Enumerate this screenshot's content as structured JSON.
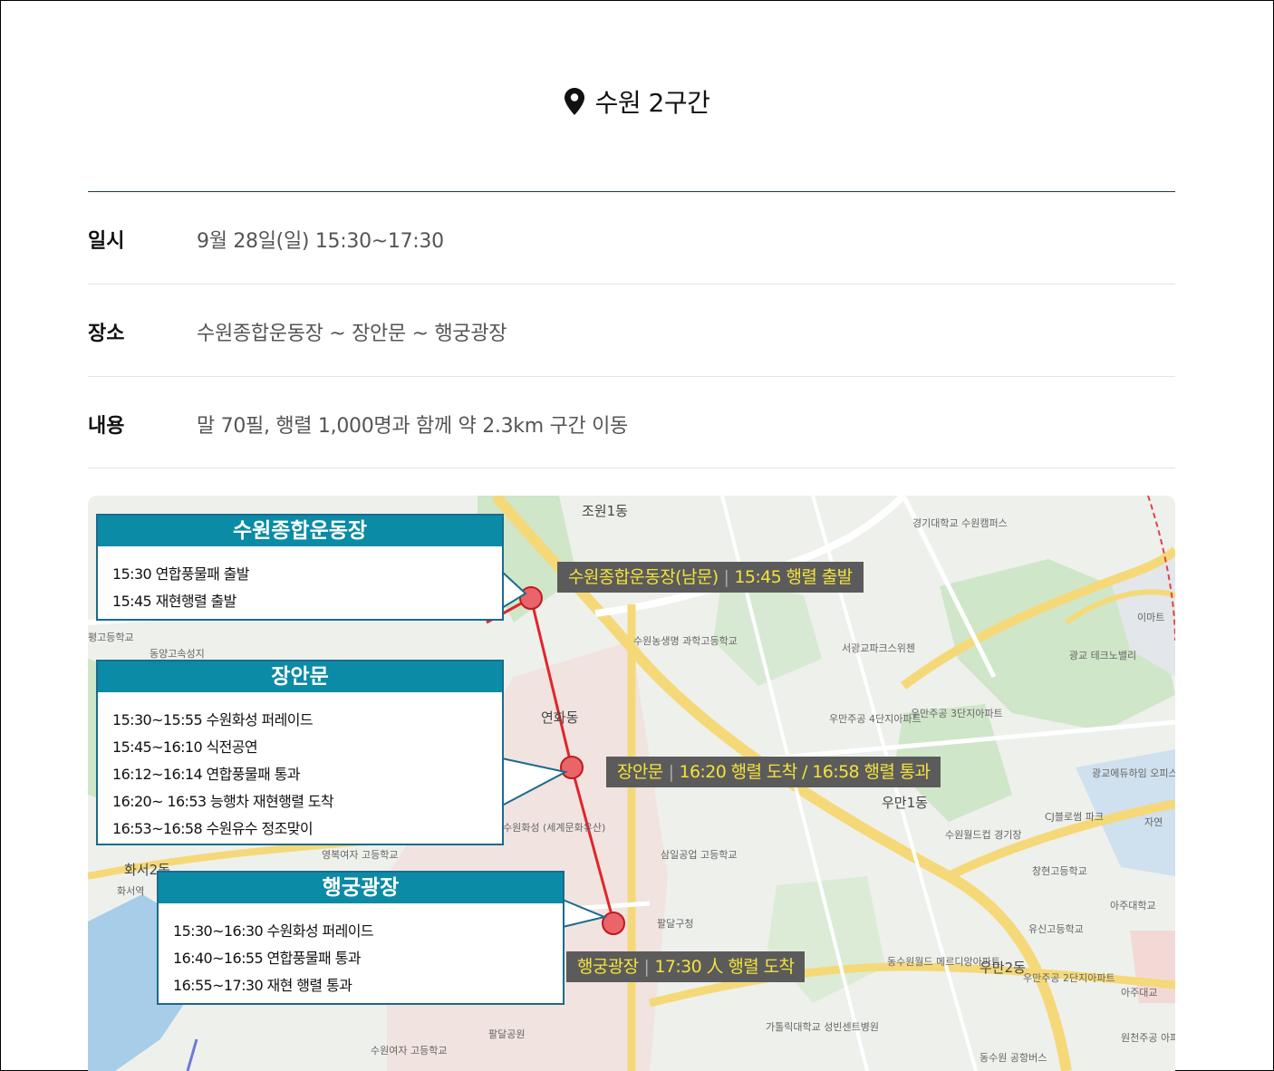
{
  "header": {
    "title": "수원 2구간"
  },
  "info": [
    {
      "label": "일시",
      "value": "9월 28일(일) 15:30~17:30"
    },
    {
      "label": "장소",
      "value": "수원종합운동장 ~ 장안문 ~ 행궁광장"
    },
    {
      "label": "내용",
      "value": "말 70필, 행렬 1,000명과 함께 약 2.3km 구간 이동"
    }
  ],
  "map": {
    "route_color": "#e0262b",
    "stops": [
      {
        "name": "수원종합운동장",
        "schedule": [
          "15:30 연합풍물패 출발",
          "15:45 재현행렬 출발"
        ],
        "tag_place": "수원종합운동장(남문)",
        "tag_text": "15:45 행렬 출발"
      },
      {
        "name": "장안문",
        "schedule": [
          "15:30~15:55 수원화성 퍼레이드",
          "15:45~16:10 식전공연",
          "16:12~16:14 연합풍물패 통과",
          "16:20~ 16:53 능행차 재현행렬 도착",
          "16:53~16:58 수원유수 정조맞이"
        ],
        "tag_place": "장안문",
        "tag_text": "16:20 행렬 도착 / 16:58 행렬 통과"
      },
      {
        "name": "행궁광장",
        "schedule": [
          "15:30~16:30 수원화성 퍼레이드",
          "16:40~16:55 연합풍물패 통과",
          "16:55~17:30 재현 행렬 통과"
        ],
        "tag_place": "행궁광장",
        "tag_text": "17:30 人 행렬 도착"
      }
    ],
    "labels": [
      "조원1동",
      "경기대학교 수원캠퍼스",
      "이마트",
      "서광교파크스위첸",
      "광교 테크노밸리",
      "수원농생명 과학고등학교",
      "우만주공 4단지아파트",
      "우만주공 3단지아파트",
      "광교에듀하임 오피스텔",
      "연화동",
      "우만1동",
      "CJ블로썸 파크",
      "자연",
      "수원월드컵 경기장",
      "창현고등학교",
      "아주대학교",
      "삼일공업 고등학교",
      "팔달구청",
      "유신고등학교",
      "동수원월드 메르디앙아파트",
      "우만2동",
      "우만주공 2단지아파트",
      "아주대교",
      "가톨릭대학교 성빈센트병원",
      "팔달공원",
      "수원여자 고등학교",
      "동수원 공항버스",
      "원천주공 아파트",
      "동양고속성지",
      "평고등학교",
      "영복여자 고등학교",
      "화서역",
      "화서2동",
      "수원화성 (세계문화유산)"
    ]
  }
}
